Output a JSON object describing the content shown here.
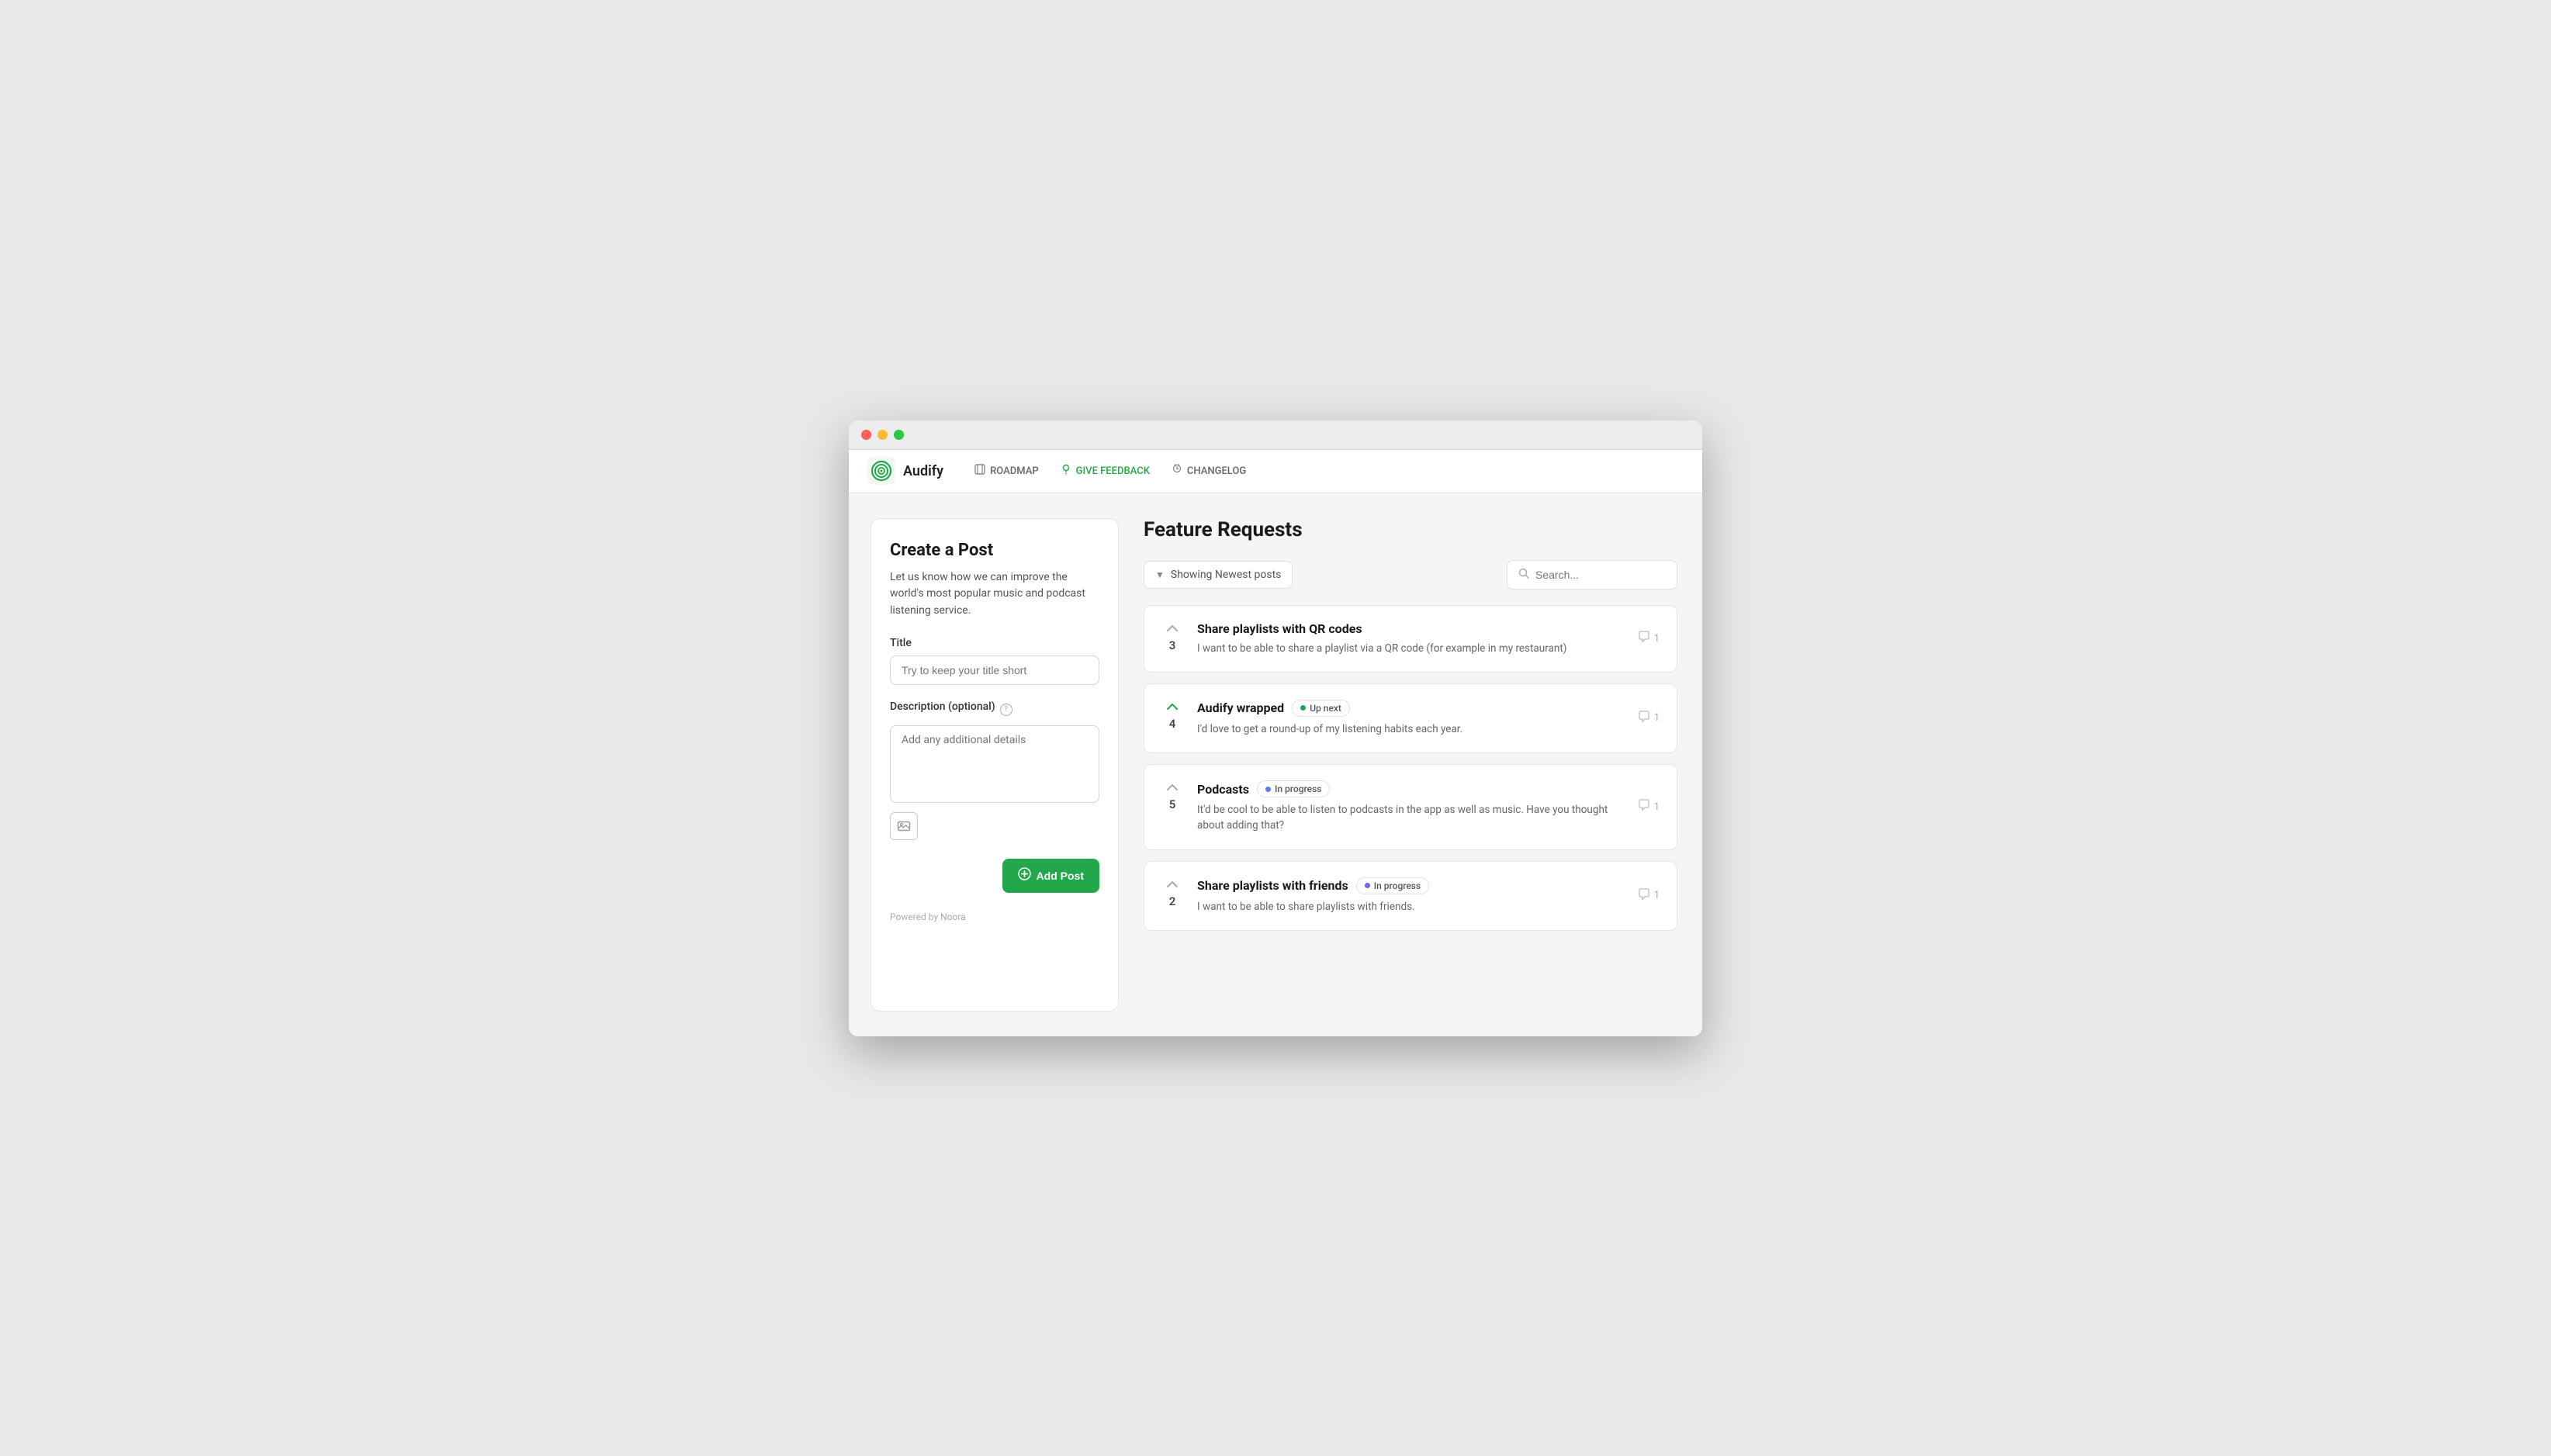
{
  "browser": {
    "traffic": [
      "red",
      "yellow",
      "green"
    ]
  },
  "navbar": {
    "logo_text": "Audify",
    "links": [
      {
        "id": "roadmap",
        "label": "ROADMAP",
        "icon": "📅",
        "active": false
      },
      {
        "id": "give-feedback",
        "label": "GIVE FEEDBACK",
        "icon": "💡",
        "active": true
      },
      {
        "id": "changelog",
        "label": "CHANGELOG",
        "icon": "🔔",
        "active": false
      }
    ]
  },
  "create_post": {
    "title": "Create a Post",
    "description": "Let us know how we can improve the world's most popular music and podcast listening service.",
    "title_label": "Title",
    "title_placeholder": "Try to keep your title short",
    "description_label": "Description (optional)",
    "description_placeholder": "Add any additional details",
    "add_button_label": "Add Post",
    "powered_by": "Powered by Noora"
  },
  "feature_requests": {
    "page_title": "Feature Requests",
    "filter_label": "Showing Newest posts",
    "search_placeholder": "Search...",
    "posts": [
      {
        "id": "post-1",
        "vote_count": "3",
        "title": "Share playlists with QR codes",
        "excerpt": "I want to be able to share a playlist via a QR code (for example in my restaurant)",
        "comments": "1",
        "status": null,
        "voted": false
      },
      {
        "id": "post-2",
        "vote_count": "4",
        "title": "Audify wrapped",
        "excerpt": "I'd love to get a round-up of my listening habits each year.",
        "comments": "1",
        "status": "Up next",
        "status_dot": "dot-green",
        "voted": true
      },
      {
        "id": "post-3",
        "vote_count": "5",
        "title": "Podcasts",
        "excerpt": "It'd be cool to be able to listen to podcasts in the app as well as music. Have you thought about adding that?",
        "comments": "1",
        "status": "In progress",
        "status_dot": "dot-blue",
        "voted": false
      },
      {
        "id": "post-4",
        "vote_count": "2",
        "title": "Share playlists with friends",
        "excerpt": "I want to be able to share playlists with friends.",
        "comments": "1",
        "status": "In progress",
        "status_dot": "dot-purple",
        "voted": false
      }
    ]
  },
  "colors": {
    "accent": "#22a84a",
    "brand": "#22a84a"
  }
}
